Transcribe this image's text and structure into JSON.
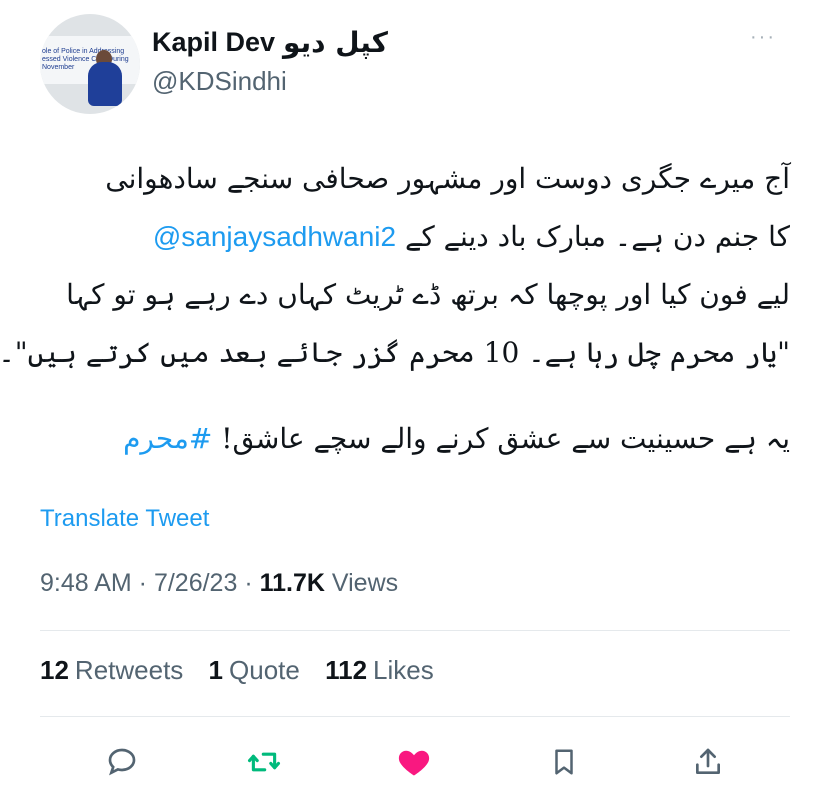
{
  "author": {
    "display_name": "Kapil Dev",
    "display_name_urdu": "کپل دیو",
    "handle": "@KDSindhi",
    "avatar_caption": [
      "ole of Police in Addressing",
      "essed Violence Ca... During",
      "November"
    ]
  },
  "more_label": "···",
  "tweet": {
    "line1": "آج میرے جگری دوست اور  مشہور صحافی سنجے سادھوانی",
    "line2_text": " کا جنم دن ہے۔ مبارک باد دینے کے",
    "line2_mention": "@sanjaysadhwani2",
    "line3": "لیے فون کیا اور پوچھا کہ برتھ ڈے ٹریٹ کہاں دے رہے ہو تو کہا",
    "line4": "\"یار محرم چل رہا ہے۔ 10 محرم گزر جائے بعد میں کرتے ہیں\"۔",
    "line5_text": "یہ ہے حسینیت سے عشق کرنے والے سچے عاشق! ",
    "line5_hashtag": "#محرم"
  },
  "translate_label": "Translate Tweet",
  "meta": {
    "time": "9:48 AM",
    "sep1": " · ",
    "date": "7/26/23",
    "sep2": " · ",
    "views_count": "11.7K",
    "views_label": " Views"
  },
  "stats": {
    "retweets_count": "12",
    "retweets_label": "Retweets",
    "quotes_count": "1",
    "quotes_label": "Quote",
    "likes_count": "112",
    "likes_label": "Likes"
  },
  "colors": {
    "link": "#1d9bf0",
    "retweet_green": "#00ba7c",
    "like_pink": "#f91880",
    "secondary_text": "#536471"
  },
  "icons": [
    "reply-icon",
    "retweet-icon",
    "like-icon",
    "bookmark-icon",
    "share-icon"
  ]
}
